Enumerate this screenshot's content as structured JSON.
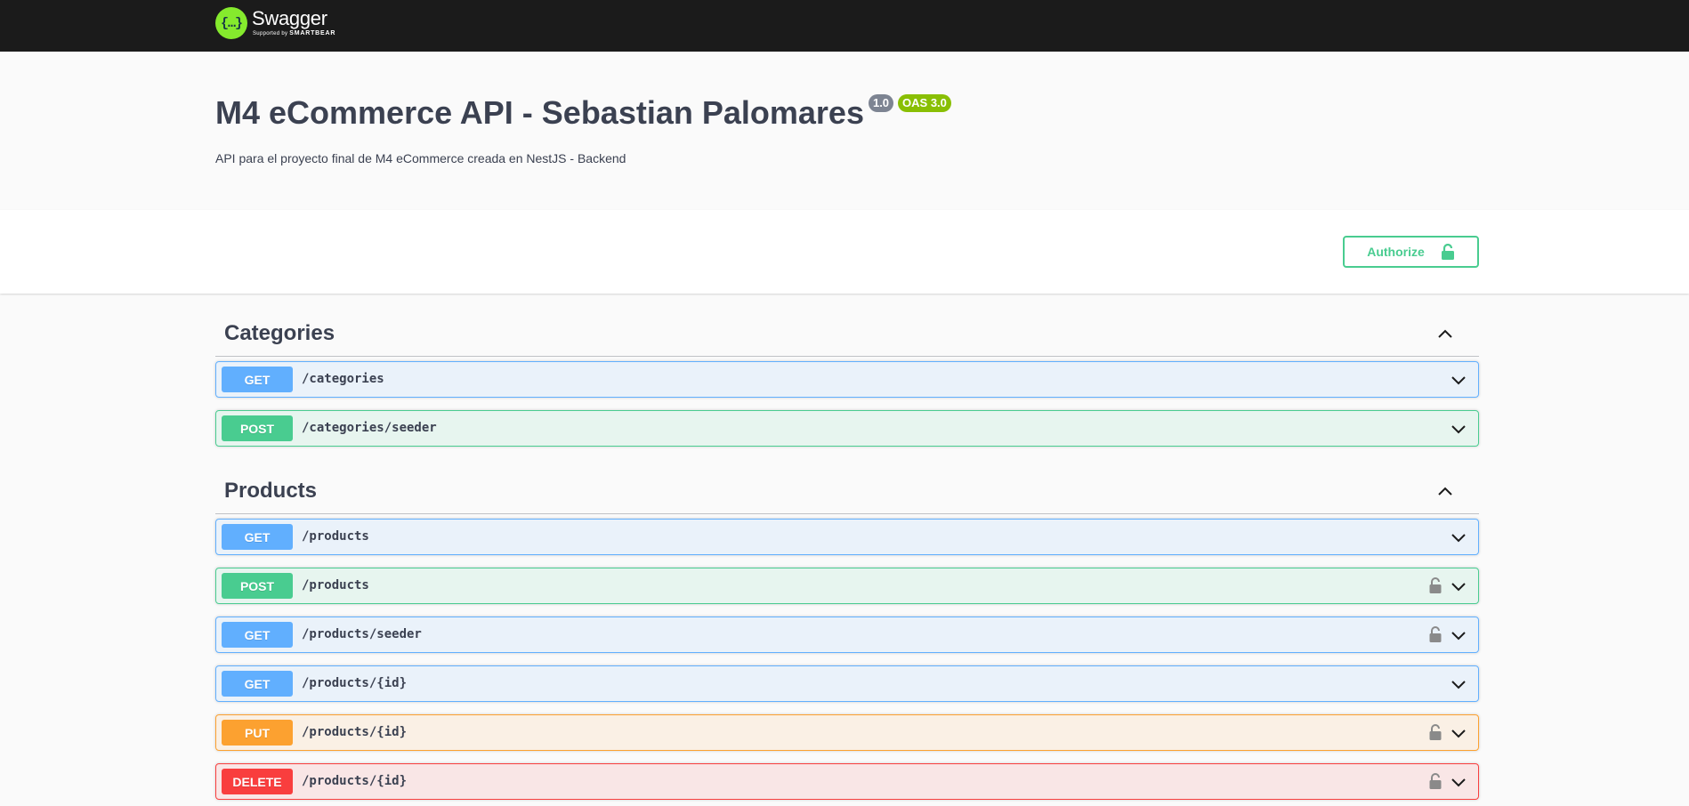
{
  "topbar": {
    "logo_glyph": "{…}",
    "brand_name": "Swagger",
    "brand_sub_prefix": "Supported by",
    "brand_sub_company": "SMARTBEAR"
  },
  "info": {
    "title": "M4 eCommerce API - Sebastian Palomares",
    "version": "1.0",
    "oas": "OAS 3.0",
    "description": "API para el proyecto final de M4 eCommerce creada en NestJS - Backend"
  },
  "scheme": {
    "authorize_label": "Authorize"
  },
  "colors": {
    "get": "#61affe",
    "post": "#49cc90",
    "put": "#fca130",
    "delete": "#f93e3e",
    "topbar": "#1b1b1b",
    "brand_green": "#85ea2d"
  },
  "tags": [
    {
      "name": "Categories",
      "operations": [
        {
          "method": "GET",
          "path": "/categories",
          "locked": false
        },
        {
          "method": "POST",
          "path": "/categories/seeder",
          "locked": false
        }
      ]
    },
    {
      "name": "Products",
      "operations": [
        {
          "method": "GET",
          "path": "/products",
          "locked": false
        },
        {
          "method": "POST",
          "path": "/products",
          "locked": true
        },
        {
          "method": "GET",
          "path": "/products/seeder",
          "locked": true
        },
        {
          "method": "GET",
          "path": "/products/{id}",
          "locked": false
        },
        {
          "method": "PUT",
          "path": "/products/{id}",
          "locked": true
        },
        {
          "method": "DELETE",
          "path": "/products/{id}",
          "locked": true
        }
      ]
    }
  ]
}
